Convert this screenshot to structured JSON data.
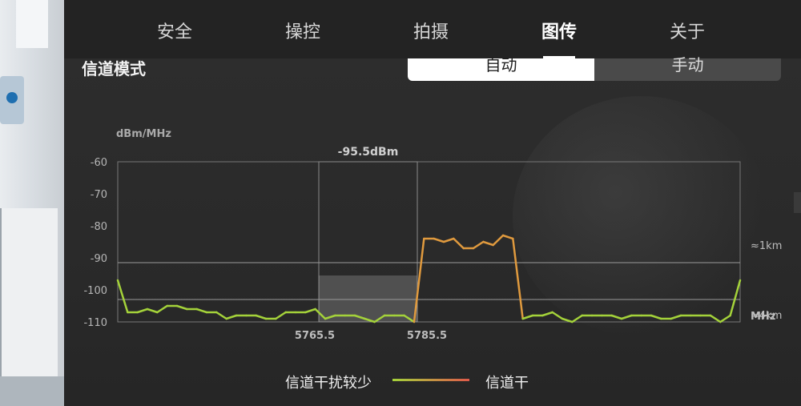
{
  "tabs": [
    {
      "label": "安全",
      "active": false
    },
    {
      "label": "操控",
      "active": false
    },
    {
      "label": "拍摄",
      "active": false
    },
    {
      "label": "图传",
      "active": true
    },
    {
      "label": "关于",
      "active": false
    }
  ],
  "channel_mode": {
    "label": "信道模式",
    "options": [
      "自动",
      "手动"
    ],
    "selected": "自动"
  },
  "chart_data": {
    "type": "line",
    "ylabel": "dBm/MHz",
    "xlabel": "MHz",
    "ylim": [
      -110,
      -60
    ],
    "yticks": [
      "-60",
      "-70",
      "-80",
      "-90",
      "-100",
      "-110"
    ],
    "xticks": [
      "5765.5",
      "5785.5"
    ],
    "selected_band": {
      "from": "5765.5",
      "to": "5785.5",
      "value_label": "-95.5dBm",
      "value": -95.5
    },
    "reference_lines": [
      {
        "label": "≈1km",
        "value": -91.5
      },
      {
        "label": "≈4km",
        "value": -103
      }
    ],
    "x_index_range": [
      0,
      64
    ],
    "series": {
      "values": [
        -97,
        -107,
        -107,
        -106,
        -107,
        -105,
        -105,
        -106,
        -106,
        -107,
        -107,
        -109,
        -108,
        -108,
        -108,
        -109,
        -109,
        -107,
        -107,
        -107,
        -106,
        -109,
        -108,
        -108,
        -108,
        -109,
        -110,
        -108,
        -108,
        -108,
        -110,
        -84,
        -84,
        -85,
        -84,
        -87,
        -87,
        -85,
        -86,
        -83,
        -84,
        -109,
        -108,
        -108,
        -107,
        -109,
        -110,
        -108,
        -108,
        -108,
        -108,
        -109,
        -108,
        -108,
        -108,
        -109,
        -109,
        -108,
        -108,
        -108,
        -108,
        -110,
        -108,
        -97
      ],
      "low_color": "#a4d23a",
      "high_color": "#e09a3e",
      "threshold": -95
    },
    "legend": [
      {
        "label": "信道干扰较少",
        "colors": [
          "#a4d23a",
          "#e05a4a"
        ]
      },
      {
        "label": "信道干"
      }
    ],
    "grid": true
  }
}
